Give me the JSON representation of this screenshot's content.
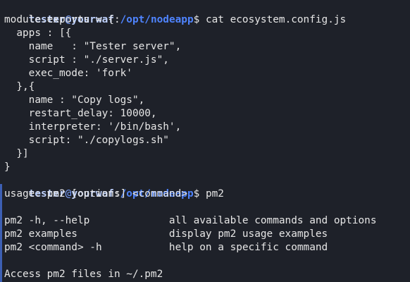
{
  "prompt1": {
    "user": "tester",
    "at": "@",
    "host": "yourwaf",
    "colon": ":",
    "path": "/opt/nodeapp",
    "dollar": "$ ",
    "command": "cat ecosystem.config.js"
  },
  "file_lines": [
    "module.exports = {",
    "  apps : [{",
    "    name   : \"Tester server\",",
    "    script : \"./server.js\",",
    "    exec_mode: 'fork'",
    "  },{",
    "    name : \"Copy logs\",",
    "    restart_delay: 10000,",
    "    interpreter: '/bin/bash',",
    "    script: \"./copylogs.sh\"",
    "  }]",
    "}"
  ],
  "prompt2": {
    "user": "tester",
    "at": "@",
    "host": "yourwaf",
    "colon": ":",
    "path": "/opt/nodeapp",
    "dollar": "$ ",
    "command": "pm2"
  },
  "pm2_output": [
    "usage: pm2 [options] <command>",
    "",
    "pm2 -h, --help             all available commands and options",
    "pm2 examples               display pm2 usage examples",
    "pm2 <command> -h           help on a specific command",
    "",
    "Access pm2 files in ~/.pm2"
  ]
}
